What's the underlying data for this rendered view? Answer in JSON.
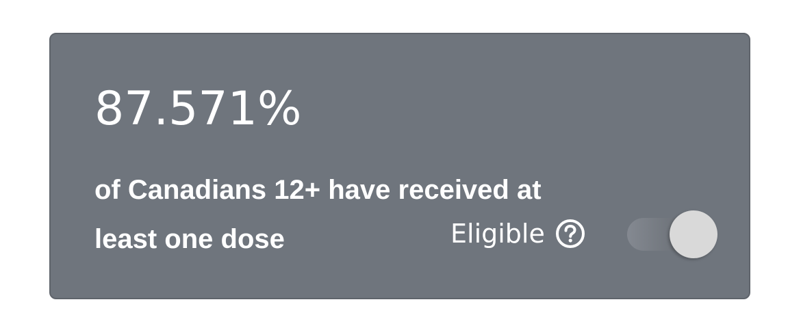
{
  "stat": {
    "value": "87.571%",
    "description_line1": "of Canadians 12+ have received at",
    "description_line2": "least one dose"
  },
  "filter": {
    "label": "Eligible",
    "help_icon": "question-circle-icon",
    "toggle_state": "on"
  },
  "colors": {
    "card_background": "#6f757d",
    "text": "#ffffff",
    "toggle_thumb": "#d9d9d9"
  }
}
